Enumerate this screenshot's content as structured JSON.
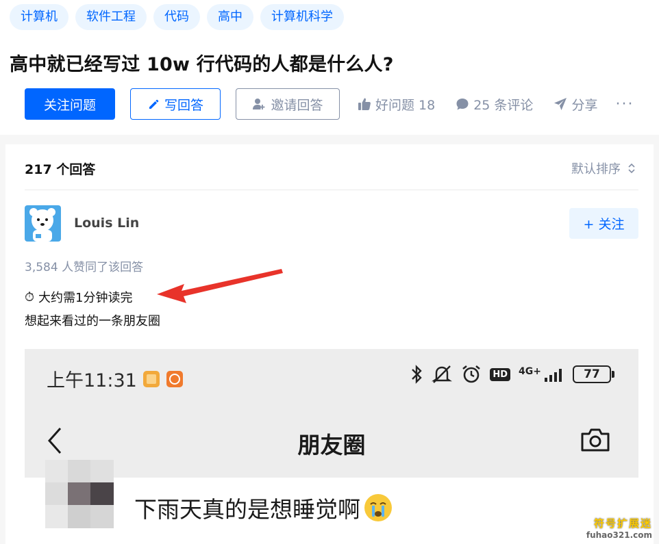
{
  "topics": [
    "计算机",
    "软件工程",
    "代码",
    "高中",
    "计算机科学"
  ],
  "question": {
    "title": "高中就已经写过 10w 行代码的人都是什么人?"
  },
  "actions": {
    "follow_label": "关注问题",
    "write_label": "写回答",
    "invite_label": "邀请回答",
    "good_question_label": "好问题 18",
    "comments_label": "25 条评论",
    "share_label": "分享",
    "more_label": "···"
  },
  "answers": {
    "count_label": "217 个回答",
    "sort_label": "默认排序"
  },
  "answer": {
    "author_name": "Louis Lin",
    "follow_label": "+ 关注",
    "upvote_text": "3,584 人赞同了该回答",
    "read_time_icon": "⏱",
    "read_time_text": "大约需1分钟读完",
    "body_text": "想起来看过的一条朋友圈"
  },
  "screenshot": {
    "time": "上午11:31",
    "battery": "77",
    "network": "4G+",
    "hd": "HD",
    "nav_title": "朋友圈",
    "post_text": "下雨天真的是想睡觉啊"
  },
  "watermark": {
    "line1": "符号扩展迷",
    "line2": "fuhao321.com"
  },
  "colors": {
    "accent": "#0066ff",
    "tag_bg": "#ebf5ff",
    "muted": "#8590a6",
    "arrow": "#e8332a"
  },
  "icons": [
    "pencil-icon",
    "add-user-icon",
    "thumbs-up-icon",
    "comment-icon",
    "share-plane-icon",
    "sort-icon",
    "stopwatch-icon",
    "bluetooth-icon",
    "mute-icon",
    "alarm-icon",
    "signal-icon",
    "back-chevron-icon",
    "camera-icon",
    "crying-emoji-icon"
  ]
}
